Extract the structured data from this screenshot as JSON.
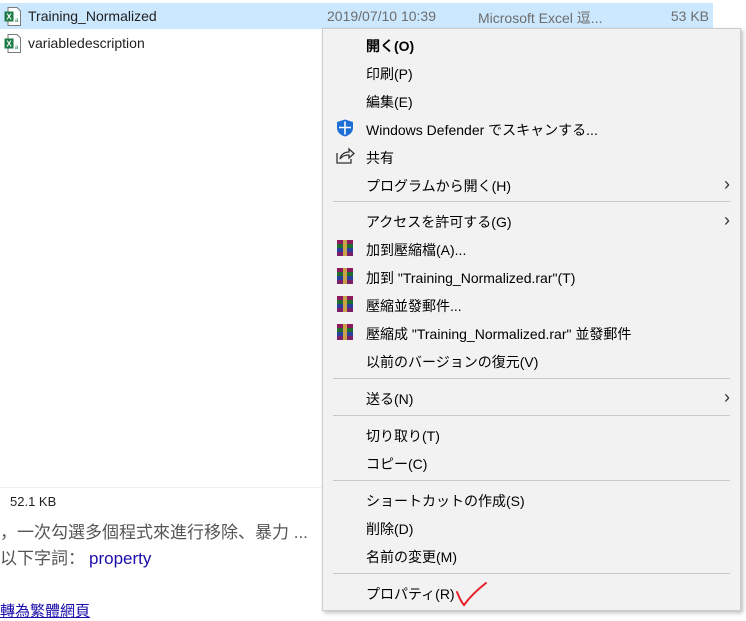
{
  "files": [
    {
      "name": "Training_Normalized",
      "date": "2019/07/10 10:39",
      "type": "Microsoft Excel 逗...",
      "size": "53 KB",
      "selected": true
    },
    {
      "name": "variabledescription",
      "date": "",
      "type": "",
      "size": "",
      "selected": false
    }
  ],
  "status": {
    "size": "52.1 KB"
  },
  "background": {
    "line1": "，一次勾選多個程式來進行移除、暴力 ...",
    "line2_prefix": "以下字詞：",
    "line2_keyword": "property",
    "line3": "轉為繁體網頁"
  },
  "menu": {
    "items": [
      {
        "label": "開く(O)",
        "icon": "",
        "bold": true
      },
      {
        "label": "印刷(P)",
        "icon": ""
      },
      {
        "label": "編集(E)",
        "icon": ""
      },
      {
        "label": "Windows Defender でスキャンする...",
        "icon": "shield-icon"
      },
      {
        "label": "共有",
        "icon": "share-icon"
      },
      {
        "label": "プログラムから開く(H)",
        "icon": "",
        "submenu": true
      },
      {
        "label": "アクセスを許可する(G)",
        "icon": "",
        "submenu": true
      },
      {
        "label": "加到壓縮檔(A)...",
        "icon": "winrar-icon"
      },
      {
        "label": "加到 \"Training_Normalized.rar\"(T)",
        "icon": "winrar-icon"
      },
      {
        "label": "壓縮並發郵件...",
        "icon": "winrar-icon"
      },
      {
        "label": "壓縮成 \"Training_Normalized.rar\" 並發郵件",
        "icon": "winrar-icon"
      },
      {
        "label": "以前のバージョンの復元(V)",
        "icon": ""
      },
      {
        "label": "送る(N)",
        "icon": "",
        "submenu": true
      },
      {
        "label": "切り取り(T)",
        "icon": ""
      },
      {
        "label": "コピー(C)",
        "icon": ""
      },
      {
        "label": "ショートカットの作成(S)",
        "icon": ""
      },
      {
        "label": "削除(D)",
        "icon": ""
      },
      {
        "label": "名前の変更(M)",
        "icon": ""
      },
      {
        "label": "プロパティ(R)",
        "icon": ""
      }
    ]
  },
  "colors": {
    "selection": "#cce8ff",
    "menu_bg": "#f2f2f2",
    "annotation": "#e8202a"
  }
}
